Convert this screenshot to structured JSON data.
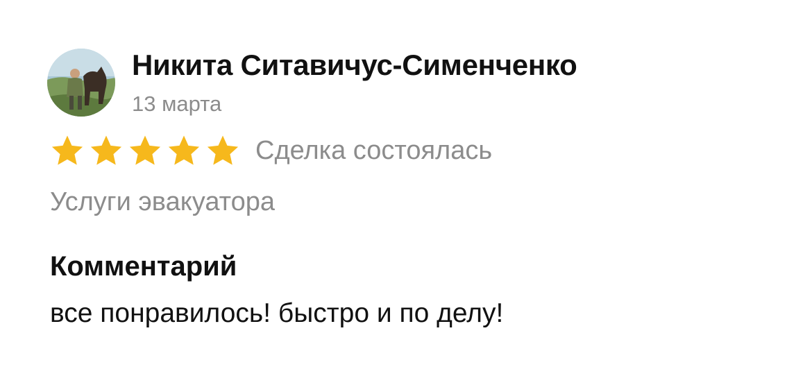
{
  "review": {
    "author_name": "Никита Ситавичус-Сименченко",
    "date": "13 марта",
    "rating": 5,
    "rating_max": 5,
    "deal_status": "Сделка состоялась",
    "service": "Услуги эвакуатора",
    "comment_heading": "Комментарий",
    "comment_text": "все понравилось! быстро и по делу!"
  },
  "colors": {
    "star": "#F6B81C",
    "primary_text": "#111111",
    "secondary_text": "#8C8C8C"
  },
  "icons": {
    "avatar": "user-avatar-photo",
    "star": "star-icon"
  }
}
